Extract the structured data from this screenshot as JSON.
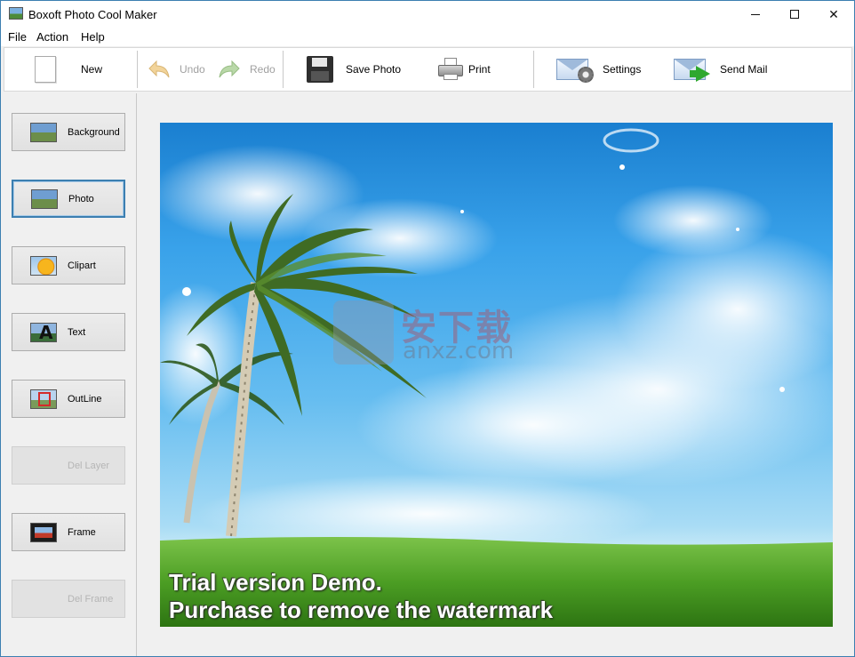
{
  "window": {
    "title": "Boxoft Photo Cool Maker"
  },
  "menu": {
    "items": [
      "File",
      "Action",
      "Help"
    ]
  },
  "toolbar": {
    "new_label": "New",
    "undo_label": "Undo",
    "redo_label": "Redo",
    "save_label": "Save Photo",
    "print_label": "Print",
    "settings_label": "Settings",
    "sendmail_label": "Send Mail"
  },
  "sidebar": {
    "items": [
      {
        "label": "Background",
        "icon": "landscape-thumb-icon",
        "enabled": true,
        "selected": false
      },
      {
        "label": "Photo",
        "icon": "landscape-thumb-icon",
        "enabled": true,
        "selected": true
      },
      {
        "label": "Clipart",
        "icon": "smiley-clipart-icon",
        "enabled": true,
        "selected": false
      },
      {
        "label": "Text",
        "icon": "text-a-icon",
        "enabled": true,
        "selected": false
      },
      {
        "label": "OutLine",
        "icon": "outline-icon",
        "enabled": true,
        "selected": false
      },
      {
        "label": "Del Layer",
        "icon": "",
        "enabled": false,
        "selected": false
      },
      {
        "label": "Frame",
        "icon": "frame-icon",
        "enabled": true,
        "selected": false
      },
      {
        "label": "Del Frame",
        "icon": "",
        "enabled": false,
        "selected": false
      }
    ]
  },
  "canvas": {
    "watermark_line1": "Trial version Demo.",
    "watermark_line2": "Purchase to remove the watermark",
    "site_logo_text": "安下载",
    "site_logo_url": "anxz.com"
  },
  "colors": {
    "accent": "#3c7fb1",
    "disabled_text": "#a0a0a0",
    "grass": "#4da32a",
    "sky": "#39a2ea"
  }
}
